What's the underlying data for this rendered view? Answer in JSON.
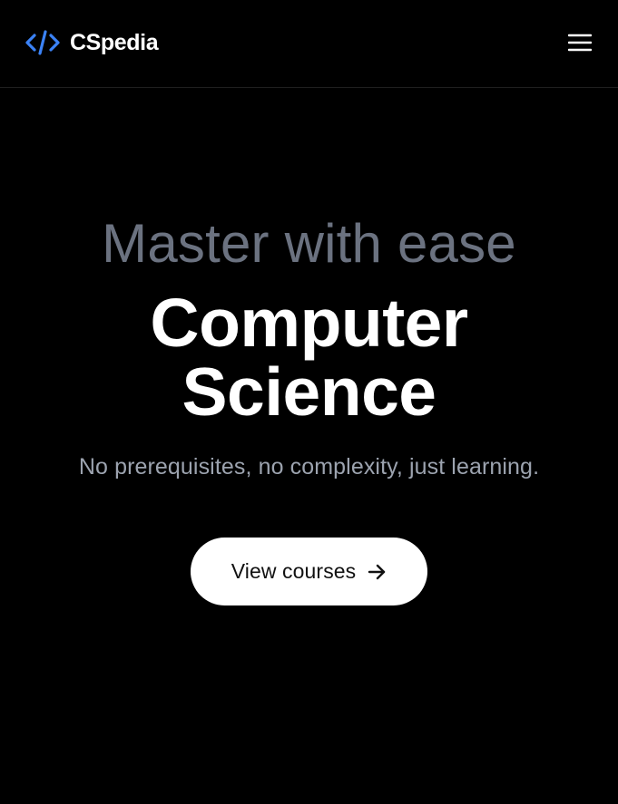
{
  "header": {
    "brand_name": "CSpedia",
    "brand_icon": "code-brackets-icon",
    "menu_icon": "hamburger-menu-icon"
  },
  "hero": {
    "kicker": "Master with ease",
    "title_line1": "Computer",
    "title_line2": "Science",
    "subtitle": "No prerequisites, no complexity, just learning.",
    "cta_label": "View courses",
    "cta_icon": "arrow-right-icon"
  },
  "colors": {
    "background": "#000000",
    "brand_accent": "#3b82f6",
    "kicker_text": "#6b7280",
    "subtitle_text": "#9ca3af",
    "cta_background": "#ffffff"
  }
}
